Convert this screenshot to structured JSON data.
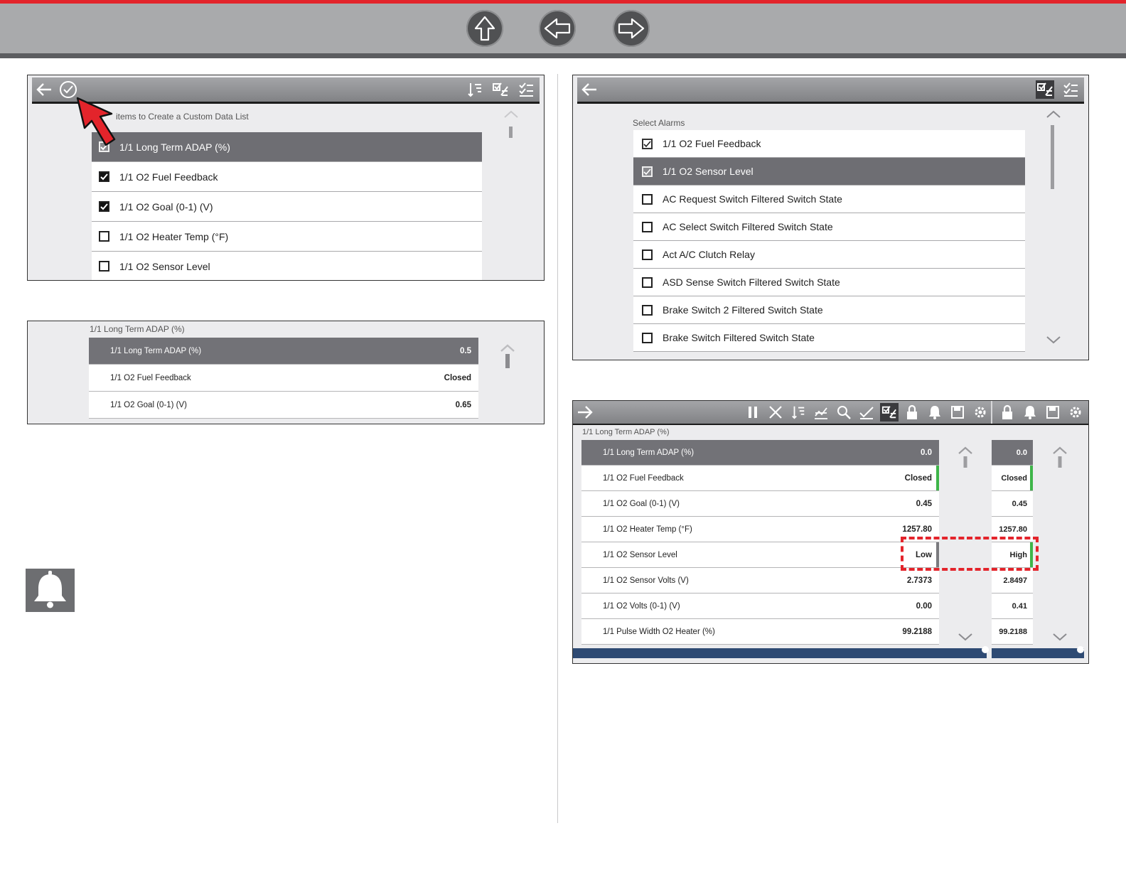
{
  "nav": {
    "up_icon": "up-arrow-icon",
    "back_icon": "left-arrow-icon",
    "forward_icon": "right-arrow-icon"
  },
  "panel_custom_list": {
    "header_label": "items to Create a Custom Data List",
    "rows": [
      {
        "label": "1/1 Long Term ADAP (%)",
        "checked": true,
        "selected": true
      },
      {
        "label": "1/1 O2 Fuel Feedback",
        "checked": true,
        "selected": false
      },
      {
        "label": "1/1 O2 Goal (0-1) (V)",
        "checked": true,
        "selected": false
      },
      {
        "label": "1/1 O2 Heater Temp (°F)",
        "checked": false,
        "selected": false
      },
      {
        "label": "1/1 O2 Sensor Level",
        "checked": false,
        "selected": false
      }
    ]
  },
  "panel_custom_view": {
    "header_label": "1/1 Long Term ADAP (%)",
    "rows": [
      {
        "label": "1/1 Long Term ADAP (%)",
        "value": "0.5",
        "selected": true
      },
      {
        "label": "1/1 O2 Fuel Feedback",
        "value": "Closed",
        "selected": false
      },
      {
        "label": "1/1 O2 Goal (0-1) (V)",
        "value": "0.65",
        "selected": false
      }
    ]
  },
  "panel_alarms": {
    "header_label": "Select Alarms",
    "rows": [
      {
        "label": "1/1 O2 Fuel Feedback",
        "checked": true,
        "selected": false
      },
      {
        "label": "1/1 O2 Sensor Level",
        "checked": true,
        "selected": true
      },
      {
        "label": "AC Request Switch Filtered Switch State",
        "checked": false,
        "selected": false
      },
      {
        "label": "AC Select Switch Filtered Switch State",
        "checked": false,
        "selected": false
      },
      {
        "label": "Act A/C Clutch Relay",
        "checked": false,
        "selected": false
      },
      {
        "label": "ASD Sense Switch Filtered Switch State",
        "checked": false,
        "selected": false
      },
      {
        "label": "Brake Switch 2 Filtered Switch State",
        "checked": false,
        "selected": false
      },
      {
        "label": "Brake Switch Filtered Switch State",
        "checked": false,
        "selected": false
      }
    ]
  },
  "panel_alarm_view": {
    "header_label": "1/1 Long Term ADAP (%)",
    "rows": [
      {
        "label": "1/1 Long Term ADAP (%)",
        "value": "0.0",
        "value2": "0.0",
        "selected": true
      },
      {
        "label": "1/1 O2 Fuel Feedback",
        "value": "Closed",
        "value2": "Closed",
        "selected": false
      },
      {
        "label": "1/1 O2 Goal (0-1) (V)",
        "value": "0.45",
        "value2": "0.45",
        "selected": false
      },
      {
        "label": "1/1 O2 Heater Temp (°F)",
        "value": "1257.80",
        "value2": "1257.80",
        "selected": false
      },
      {
        "label": "1/1 O2 Sensor Level",
        "value": "Low",
        "value2": "High",
        "selected": false
      },
      {
        "label": "1/1 O2 Sensor Volts (V)",
        "value": "2.7373",
        "value2": "2.8497",
        "selected": false
      },
      {
        "label": "1/1 O2 Volts (0-1) (V)",
        "value": "0.00",
        "value2": "0.41",
        "selected": false
      },
      {
        "label": "1/1 Pulse Width O2 Heater (%)",
        "value": "99.2188",
        "value2": "99.2188",
        "selected": false
      }
    ]
  },
  "alarm_bell_icon": "bell-icon",
  "colors": {
    "accent_red": "#e3242b",
    "selected_row": "#6e6e73",
    "status_green": "#3eb549"
  }
}
